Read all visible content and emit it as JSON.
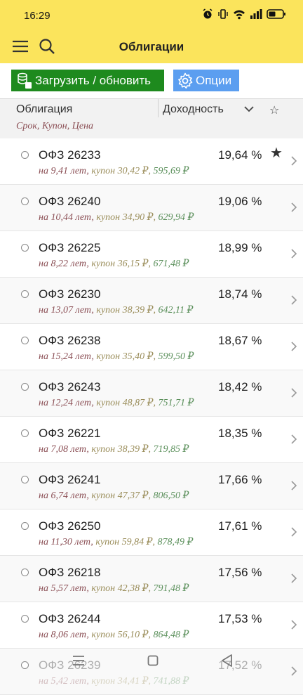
{
  "status": {
    "time": "16:29"
  },
  "app": {
    "title": "Облигации"
  },
  "toolbar": {
    "load_label": "Загрузить / обновить",
    "options_label": "Опции"
  },
  "header": {
    "col_bond": "Облигация",
    "col_bond_sub": "Срок, Купон, Цена",
    "col_yield": "Доходность",
    "star": "☆"
  },
  "rows": [
    {
      "name": "ОФЗ 26233",
      "yield": "19,64 %",
      "term": "на 9,41 лет",
      "sep1": ", ",
      "coupon": "купон 30,42 ₽",
      "sep2": ", ",
      "price": "595,69 ₽",
      "fav": "★"
    },
    {
      "name": "ОФЗ 26240",
      "yield": "19,06 %",
      "term": "на 10,44 лет",
      "sep1": ", ",
      "coupon": "купон 34,90 ₽",
      "sep2": ", ",
      "price": "629,94 ₽",
      "fav": ""
    },
    {
      "name": "ОФЗ 26225",
      "yield": "18,99 %",
      "term": "на 8,22 лет",
      "sep1": ", ",
      "coupon": "купон 36,15 ₽",
      "sep2": ", ",
      "price": "671,48 ₽",
      "fav": ""
    },
    {
      "name": "ОФЗ 26230",
      "yield": "18,74 %",
      "term": "на 13,07 лет",
      "sep1": ", ",
      "coupon": "купон 38,39 ₽",
      "sep2": ", ",
      "price": "642,11 ₽",
      "fav": ""
    },
    {
      "name": "ОФЗ 26238",
      "yield": "18,67 %",
      "term": "на 15,24 лет",
      "sep1": ", ",
      "coupon": "купон 35,40 ₽",
      "sep2": ", ",
      "price": "599,50 ₽",
      "fav": ""
    },
    {
      "name": "ОФЗ 26243",
      "yield": "18,42 %",
      "term": "на 12,24 лет",
      "sep1": ", ",
      "coupon": "купон 48,87 ₽",
      "sep2": ", ",
      "price": "751,71 ₽",
      "fav": ""
    },
    {
      "name": "ОФЗ 26221",
      "yield": "18,35 %",
      "term": "на 7,08 лет",
      "sep1": ", ",
      "coupon": "купон 38,39 ₽",
      "sep2": ", ",
      "price": "719,85 ₽",
      "fav": ""
    },
    {
      "name": "ОФЗ 26241",
      "yield": "17,66 %",
      "term": "на 6,74 лет",
      "sep1": ", ",
      "coupon": "купон 47,37 ₽",
      "sep2": ", ",
      "price": "806,50 ₽",
      "fav": ""
    },
    {
      "name": "ОФЗ 26250",
      "yield": "17,61 %",
      "term": "на 11,30 лет",
      "sep1": ", ",
      "coupon": "купон 59,84 ₽",
      "sep2": ", ",
      "price": "878,49 ₽",
      "fav": ""
    },
    {
      "name": "ОФЗ 26218",
      "yield": "17,56 %",
      "term": "на 5,57 лет",
      "sep1": ", ",
      "coupon": "купон 42,38 ₽",
      "sep2": ", ",
      "price": "791,48 ₽",
      "fav": ""
    },
    {
      "name": "ОФЗ 26244",
      "yield": "17,53 %",
      "term": "на 8,06 лет",
      "sep1": ", ",
      "coupon": "купон 56,10 ₽",
      "sep2": ", ",
      "price": "864,48 ₽",
      "fav": ""
    },
    {
      "name": "ОФЗ 26239",
      "yield": "17,52 %",
      "term": "на 5,42 лет",
      "sep1": ", ",
      "coupon": "купон 34,41 ₽",
      "sep2": ", ",
      "price": "741,88 ₽",
      "fav": ""
    }
  ],
  "colors": {
    "appbar": "#fbe45c",
    "load_button": "#1e8a1e",
    "options_button": "#5b9ef0"
  }
}
